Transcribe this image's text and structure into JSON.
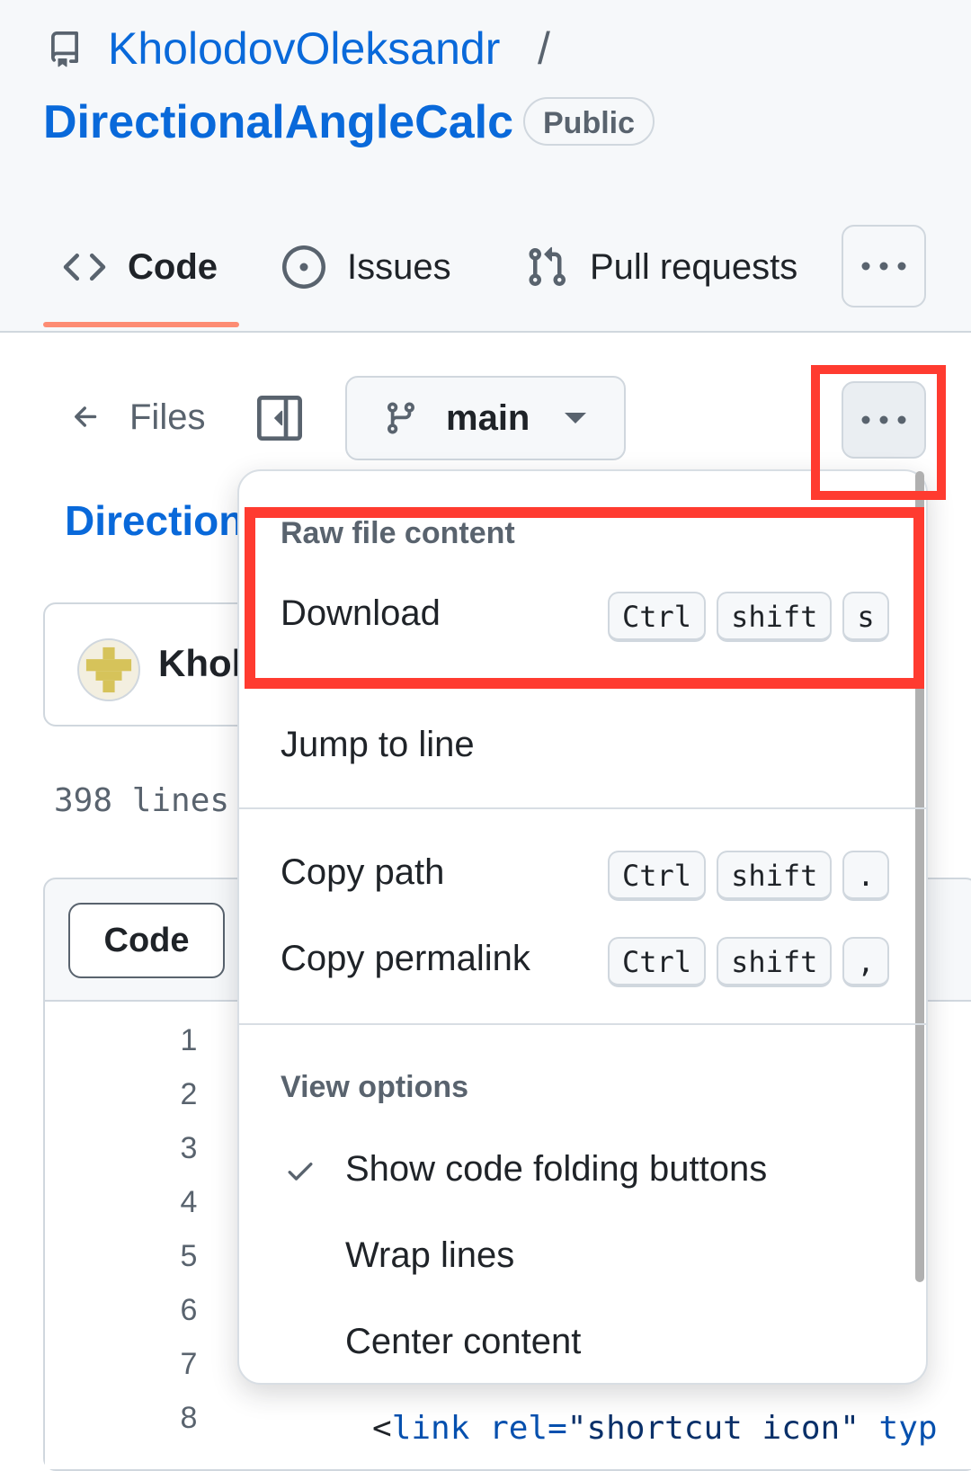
{
  "repo": {
    "owner": "KholodovOleksandr",
    "separator": "/",
    "name": "DirectionalAngleCalc",
    "visibility": "Public"
  },
  "tabs": [
    {
      "label": "Code",
      "icon": "code-icon",
      "active": true
    },
    {
      "label": "Issues",
      "icon": "issue-opened-icon"
    },
    {
      "label": "Pull requests",
      "icon": "git-pull-request-icon"
    }
  ],
  "toolbar": {
    "files_label": "Files",
    "branch": "main"
  },
  "file": {
    "path_title": "Direction",
    "commit_author": "Khol",
    "lines_count": "398 lines",
    "code_tab": "Code",
    "line_numbers": [
      "1",
      "2",
      "3",
      "4",
      "5",
      "6",
      "7",
      "8"
    ],
    "line8": {
      "open": "<",
      "tag": "link",
      "attr": " rel=",
      "val": "\"shortcut icon\"",
      "rest": " typ"
    }
  },
  "menu": {
    "raw_group": "Raw file content",
    "download": {
      "label": "Download",
      "keys": [
        "Ctrl",
        "shift",
        "s"
      ]
    },
    "jump": {
      "label": "Jump to line"
    },
    "copy_path": {
      "label": "Copy path",
      "keys": [
        "Ctrl",
        "shift",
        "."
      ]
    },
    "copy_permalink": {
      "label": "Copy permalink",
      "keys": [
        "Ctrl",
        "shift",
        ","
      ]
    },
    "view_group": "View options",
    "show_folding": {
      "label": "Show code folding buttons",
      "checked": true
    },
    "wrap_lines": {
      "label": "Wrap lines"
    },
    "center_content": {
      "label": "Center content"
    }
  },
  "colors": {
    "link": "#0969da",
    "highlight": "#ff3b30",
    "tab_underline": "#fd8c73"
  }
}
